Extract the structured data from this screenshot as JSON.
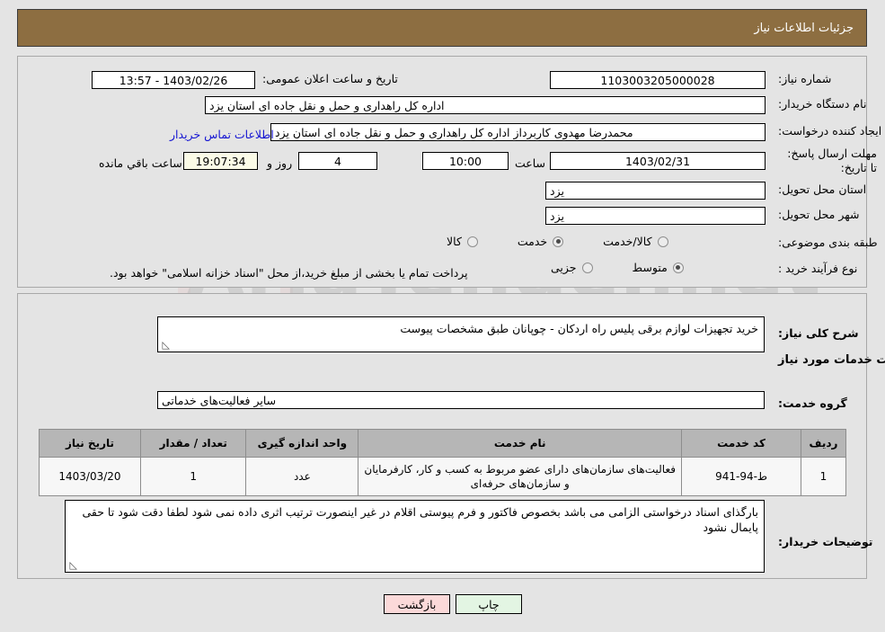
{
  "header": {
    "title": "جزئیات اطلاعات نیاز"
  },
  "top_panel": {
    "need_number": {
      "label": "شماره نیاز:",
      "value": "1103003205000028"
    },
    "announce_datetime": {
      "label": "تاریخ و ساعت اعلان عمومی:",
      "value": "1403/02/26 - 13:57"
    },
    "buyer_org": {
      "label": "نام دستگاه خریدار:",
      "value": "اداره کل راهداری و حمل و نقل جاده ای استان یزد"
    },
    "request_creator": {
      "label": "ایجاد کننده درخواست:",
      "value": "محمدرضا مهدوی کاربرداز اداره کل راهداری و حمل و نقل جاده ای استان یزد"
    },
    "buyer_contact_link": "اطلاعات تماس خریدار",
    "deadline": {
      "label": "مهلت ارسال پاسخ: تا تاریخ:",
      "date": "1403/02/31",
      "time_label": "ساعت",
      "time": "10:00",
      "days": "4",
      "days_label": "روز و",
      "countdown": "19:07:34",
      "countdown_label": "ساعت باقي مانده"
    },
    "province": {
      "label": "استان محل تحویل:",
      "value": "یزد"
    },
    "city": {
      "label": "شهر محل تحویل:",
      "value": "یزد"
    },
    "category": {
      "label": "طبقه بندی موضوعی:",
      "options": [
        {
          "label": "کالا",
          "selected": false
        },
        {
          "label": "خدمت",
          "selected": true
        },
        {
          "label": "کالا/خدمت",
          "selected": false
        }
      ]
    },
    "purchase_type": {
      "label": "نوع فرآیند خرید :",
      "options": [
        {
          "label": "جزیی",
          "selected": false
        },
        {
          "label": "متوسط",
          "selected": true
        }
      ],
      "note": "پرداخت تمام یا بخشی از مبلغ خرید،از محل \"اسناد خزانه اسلامی\" خواهد بود."
    }
  },
  "bottom_panel": {
    "general_description": {
      "label": "شرح کلی نیاز:",
      "value": "خرید تجهیزات لوازم برقی پلیس راه اردکان - چوپانان طبق مشخصات پیوست"
    },
    "services_section_title": "اطلاعات خدمات مورد نیاز",
    "service_group": {
      "label": "گروه خدمت:",
      "value": "سایر فعالیت‌های خدماتی"
    },
    "table": {
      "columns": [
        "ردیف",
        "کد خدمت",
        "نام خدمت",
        "واحد اندازه گیری",
        "تعداد / مقدار",
        "تاریخ نیاز"
      ],
      "rows": [
        {
          "row_no": "1",
          "service_code": "ط-94-941",
          "service_name": "فعالیت‌های سازمان‌های دارای عضو مربوط به کسب و کار، کارفرمایان و سازمان‌های حرفه‌ای",
          "unit": "عدد",
          "quantity": "1",
          "need_date": "1403/03/20"
        }
      ]
    },
    "buyer_notes": {
      "label": "توضیحات خریدار:",
      "value": "بارگذای اسناد درخواستی الزامی می باشد بخصوص فاکتور و فرم پیوستی اقلام در غیر اینصورت ترتیب اثری داده نمی شود لطفا دقت شود تا حقی پایمال نشود"
    }
  },
  "footer": {
    "print_label": "چاپ",
    "back_label": "بازگشت"
  },
  "watermark": {
    "text": "AriaTender.net"
  },
  "colors": {
    "header_brown": "#8d6e41",
    "page_bg": "#e4e4e4",
    "link_blue": "#1414d2",
    "countdown_bg": "#fbfbe7",
    "print_btn": "#e3f5e3",
    "back_btn": "#fbd9d9",
    "table_header": "#b6b6b6"
  }
}
